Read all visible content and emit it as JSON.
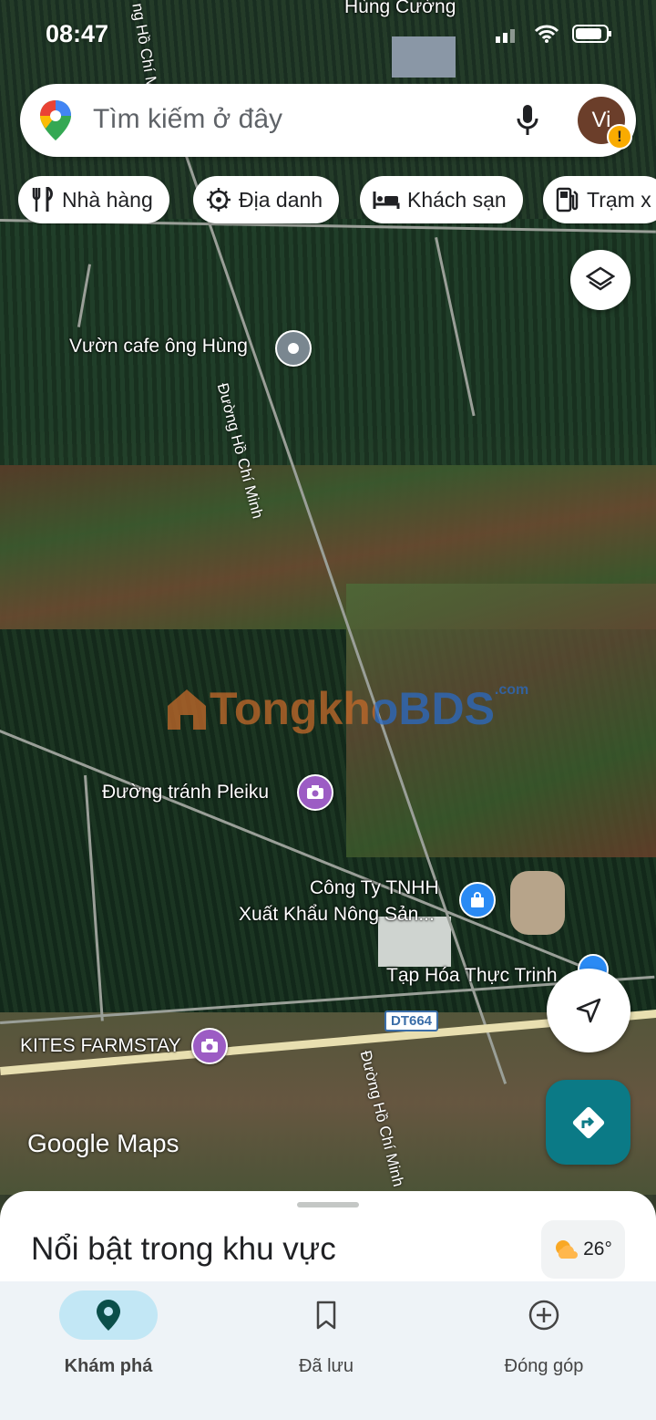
{
  "status_bar": {
    "time": "08:47"
  },
  "search": {
    "placeholder": "Tìm kiếm ở đây",
    "avatar_initials": "Vi"
  },
  "chips": [
    {
      "label": "Nhà hàng",
      "icon": "restaurant-icon"
    },
    {
      "label": "Địa danh",
      "icon": "landmark-icon"
    },
    {
      "label": "Khách sạn",
      "icon": "hotel-icon"
    },
    {
      "label": "Trạm x",
      "icon": "gas-station-icon"
    }
  ],
  "map": {
    "labels": {
      "top_place": "Hùng Cường",
      "cafe": "Vườn cafe ông Hùng",
      "bypass": "Đường tránh Pleiku",
      "company_line1": "Công Ty TNHH",
      "company_line2": "Xuất Khẩu Nông Sản...",
      "store": "Tạp Hóa Thực Trinh",
      "farmstay": "KITES FARMSTAY",
      "road_ho_chi_minh": "Đường Hồ Chí Minh",
      "road_ho_chi_minh_2": "Đường Hồ Chí Minh",
      "road_ho_chi_minh_top": "ng Hồ Chí M",
      "highway_badge": "DT664",
      "watermark": "TongkhoBDS",
      "watermark_suffix": ".com"
    },
    "attribution": "Google Maps"
  },
  "sheet": {
    "title": "Nổi bật trong khu vực",
    "weather": "26°"
  },
  "nav": [
    {
      "label": "Khám phá",
      "icon": "explore-pin-icon",
      "active": true
    },
    {
      "label": "Đã lưu",
      "icon": "bookmark-icon",
      "active": false
    },
    {
      "label": "Đóng góp",
      "icon": "add-circle-icon",
      "active": false
    }
  ],
  "colors": {
    "active_pill": "#c2e7f5",
    "directions_button": "#0b7a86",
    "pin_purple": "#9c5cc4",
    "pin_blue": "#2a8af4",
    "pin_gray": "#7a8790"
  }
}
